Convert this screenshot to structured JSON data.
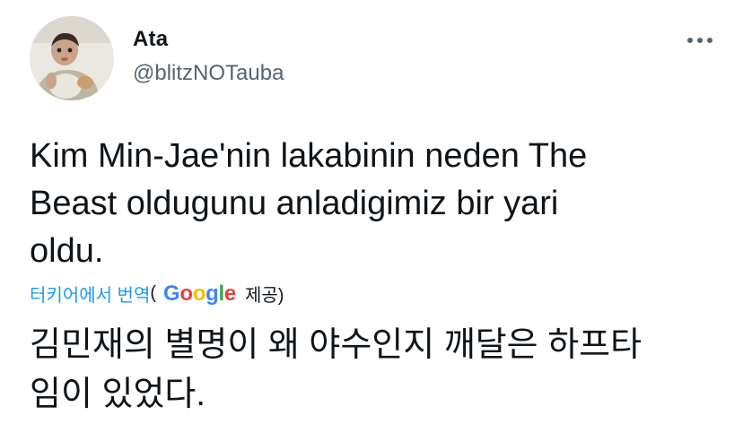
{
  "tweet": {
    "author_name": "Ata",
    "author_handle": "@blitzNOTauba",
    "text_lines": [
      "Kim Min-Jae'nin lakabinin neden The",
      "Beast oldugunu anladigimiz bir yari",
      "oldu."
    ],
    "translate": {
      "link_label": "터키어에서 번역",
      "open_paren": "(",
      "google_letters": [
        "G",
        "o",
        "o",
        "g",
        "l",
        "e"
      ],
      "provided_label": "제공)"
    },
    "translated_lines": [
      "김민재의 별명이 왜 야수인지 깨달은 하프타",
      "임이 있었다."
    ]
  },
  "icons": {
    "more": "more-options-icon",
    "avatar": "profile-photo"
  },
  "colors": {
    "text": "#0f1419",
    "secondary": "#536471",
    "link": "#1d9bf0",
    "google_blue": "#4285f4",
    "google_red": "#ea4335",
    "google_yellow": "#fbbc05",
    "google_green": "#34a853"
  }
}
